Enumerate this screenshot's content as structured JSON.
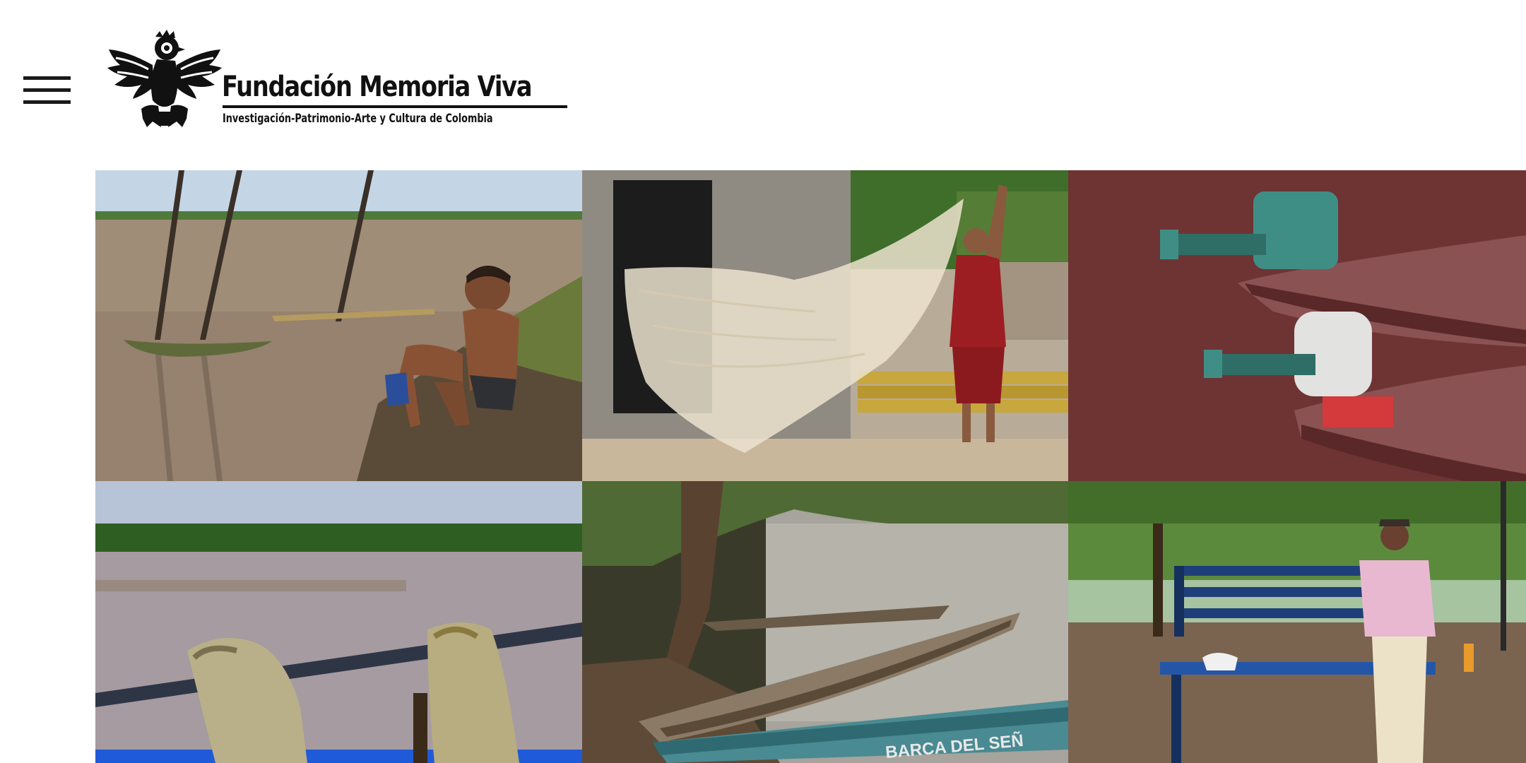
{
  "header": {
    "menu_icon": "hamburger-menu-icon",
    "logo": {
      "emblem_icon": "bird-emblem-icon",
      "title": "Fundación Memoria Viva",
      "subtitle": "Investigación-Patrimonio-Arte y Cultura de Colombia"
    }
  },
  "gallery": {
    "photos": [
      {
        "subject": "boy-on-riverbank-photo"
      },
      {
        "subject": "man-holding-fishing-net-photo"
      },
      {
        "subject": "outboard-motors-on-boats-photo"
      },
      {
        "subject": "nets-on-railing-photo"
      },
      {
        "subject": "canoes-on-river-photo"
      },
      {
        "subject": "man-on-bench-photo",
        "boat_lettering": "BARCA DEL SEÑ"
      }
    ]
  },
  "colors": {
    "text": "#111111",
    "background": "#ffffff",
    "river": "#9a8a78",
    "sky": "#b9cfe2",
    "foliage": "#3f6e2a",
    "hull_red": "#6e3434"
  }
}
